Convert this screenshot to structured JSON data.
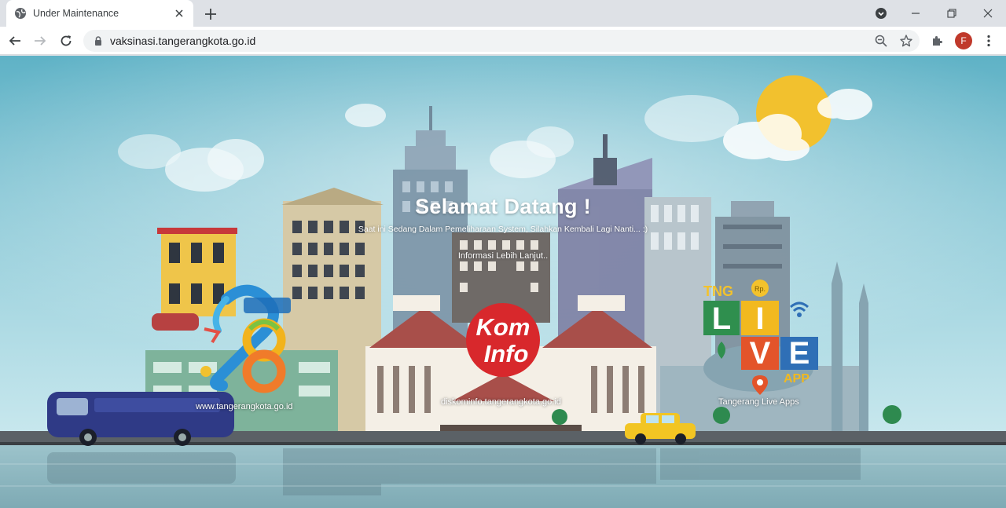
{
  "browser": {
    "tab_title": "Under Maintenance",
    "url": "vaksinasi.tangerangkota.go.id",
    "profile_initial": "F"
  },
  "page": {
    "heading": "Selamat Datang !",
    "subtext": "Saat ini Sedang Dalam Pemeliharaan System, Silahkan Kembali Lagi Nanti... :)",
    "info_link": "Informasi Lebih Lanjut..",
    "links": [
      {
        "label": "www.tangerangkota.go.id",
        "logo_icon": "tangerang-28-logo-icon"
      },
      {
        "label": "diskominfo.tangerangkota.go.id",
        "logo_icon": "kominfo-logo-icon",
        "logo_text_1": "Kom",
        "logo_text_2": "Info"
      },
      {
        "label": "Tangerang Live Apps",
        "logo_icon": "tng-live-logo-icon"
      }
    ]
  },
  "colors": {
    "sky_top": "#63b5c9",
    "sky_bottom": "#d6eef3",
    "water": "#8fb9c2",
    "kominfo_red": "#d8282c"
  }
}
